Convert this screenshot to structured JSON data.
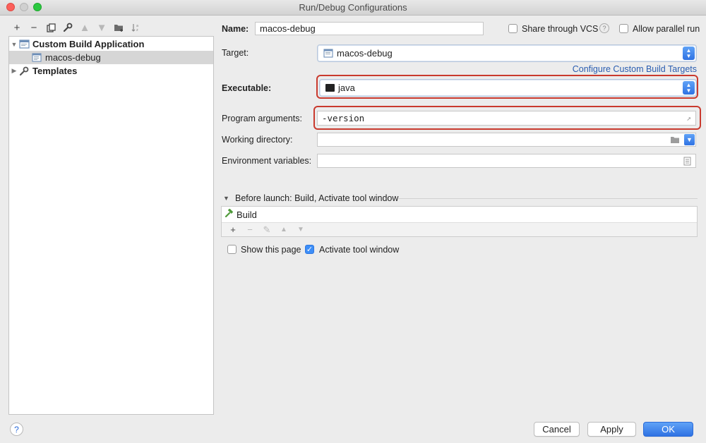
{
  "window": {
    "title": "Run/Debug Configurations"
  },
  "tree": {
    "items": [
      {
        "label": "Custom Build Application",
        "expanded": true
      },
      {
        "label": "macos-debug",
        "selected": true
      },
      {
        "label": "Templates",
        "expanded": false
      }
    ]
  },
  "form": {
    "name_label": "Name:",
    "name_value": "macos-debug",
    "share_vcs_label": "Share through VCS",
    "allow_parallel_label": "Allow parallel run",
    "target_label": "Target:",
    "target_value": "macos-debug",
    "configure_link": "Configure Custom Build Targets",
    "executable_label": "Executable:",
    "executable_value": "java",
    "program_args_label": "Program arguments:",
    "program_args_value": "-version",
    "working_dir_label": "Working directory:",
    "working_dir_value": "",
    "env_vars_label": "Environment variables:",
    "env_vars_value": ""
  },
  "before_launch": {
    "header": "Before launch: Build, Activate tool window",
    "tasks": [
      {
        "label": "Build"
      }
    ],
    "show_page_label": "Show this page",
    "show_page_checked": false,
    "activate_tool_label": "Activate tool window",
    "activate_tool_checked": true
  },
  "buttons": {
    "cancel": "Cancel",
    "apply": "Apply",
    "ok": "OK",
    "help": "?"
  },
  "colors": {
    "accent": "#2f72e3",
    "highlight": "#c93a2e",
    "link": "#2a5db0"
  }
}
